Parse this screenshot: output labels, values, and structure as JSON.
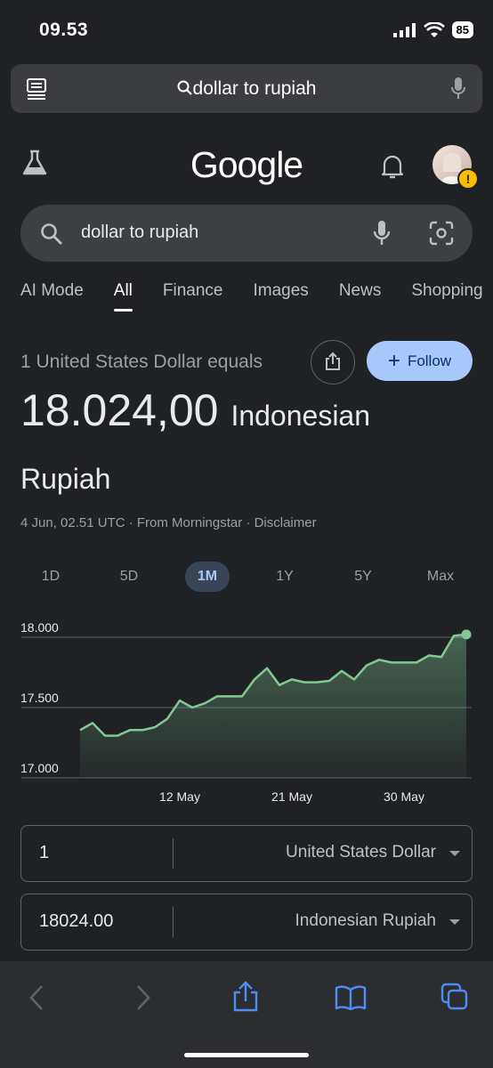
{
  "status": {
    "time": "09.53",
    "battery": "85"
  },
  "browser": {
    "url_text": "dollar to rupiah"
  },
  "google": {
    "logo": "Google"
  },
  "search": {
    "query": "dollar to rupiah"
  },
  "tabs": [
    {
      "label": "AI Mode"
    },
    {
      "label": "All",
      "active": true
    },
    {
      "label": "Finance"
    },
    {
      "label": "Images"
    },
    {
      "label": "News"
    },
    {
      "label": "Shopping"
    }
  ],
  "converter_header": {
    "equals_label": "1 United States Dollar equals",
    "follow_label": "Follow",
    "rate_value": "18.024,00",
    "rate_unit_line1": "Indonesian",
    "rate_unit_line2": "Rupiah",
    "meta": "4 Jun, 02.51 UTC · From Morningstar · Disclaimer"
  },
  "ranges": [
    {
      "label": "1D"
    },
    {
      "label": "5D"
    },
    {
      "label": "1M",
      "active": true
    },
    {
      "label": "1Y"
    },
    {
      "label": "5Y"
    },
    {
      "label": "Max"
    }
  ],
  "chart_data": {
    "type": "area",
    "y_ticks": [
      "18.000",
      "17.500",
      "17.000"
    ],
    "ylim": [
      17000,
      18000
    ],
    "x_tick_labels": [
      "12 May",
      "21 May",
      "30 May"
    ],
    "values": [
      17340,
      17390,
      17300,
      17300,
      17340,
      17340,
      17360,
      17420,
      17550,
      17500,
      17530,
      17580,
      17580,
      17580,
      17700,
      17780,
      17660,
      17700,
      17680,
      17680,
      17690,
      17760,
      17700,
      17800,
      17840,
      17820,
      17820,
      17820,
      17870,
      17860,
      18010,
      18020
    ],
    "x_tick_indices": [
      8,
      17,
      26
    ],
    "color": "#81c995"
  },
  "converter": {
    "from_amount": "1",
    "from_currency": "United States Dollar",
    "to_amount": "18024.00",
    "to_currency": "Indonesian Rupiah"
  },
  "toolbar": {
    "back_icon": "chevron-left-icon",
    "forward_icon": "chevron-right-icon",
    "share_icon": "share-icon",
    "bookmarks_icon": "book-icon",
    "tabs_icon": "tabs-icon"
  }
}
